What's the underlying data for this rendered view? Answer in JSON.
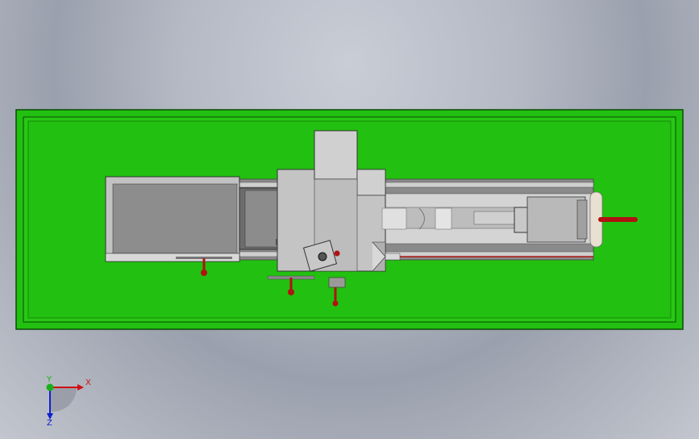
{
  "viewport": {
    "background_top": "#c9cdd6",
    "background_bottom": "#9aa0ad"
  },
  "model": {
    "base_color": "#22c010",
    "base_edge_color": "#0a4a05",
    "metal_color": "#bcbcbc",
    "metal_dark": "#8f8f8f",
    "handle_color": "#b01212"
  },
  "triad": {
    "x_label": "X",
    "y_label": "Y",
    "z_label": "Z",
    "x_color": "#d01010",
    "y_color": "#18b018",
    "z_color": "#1020d0"
  }
}
